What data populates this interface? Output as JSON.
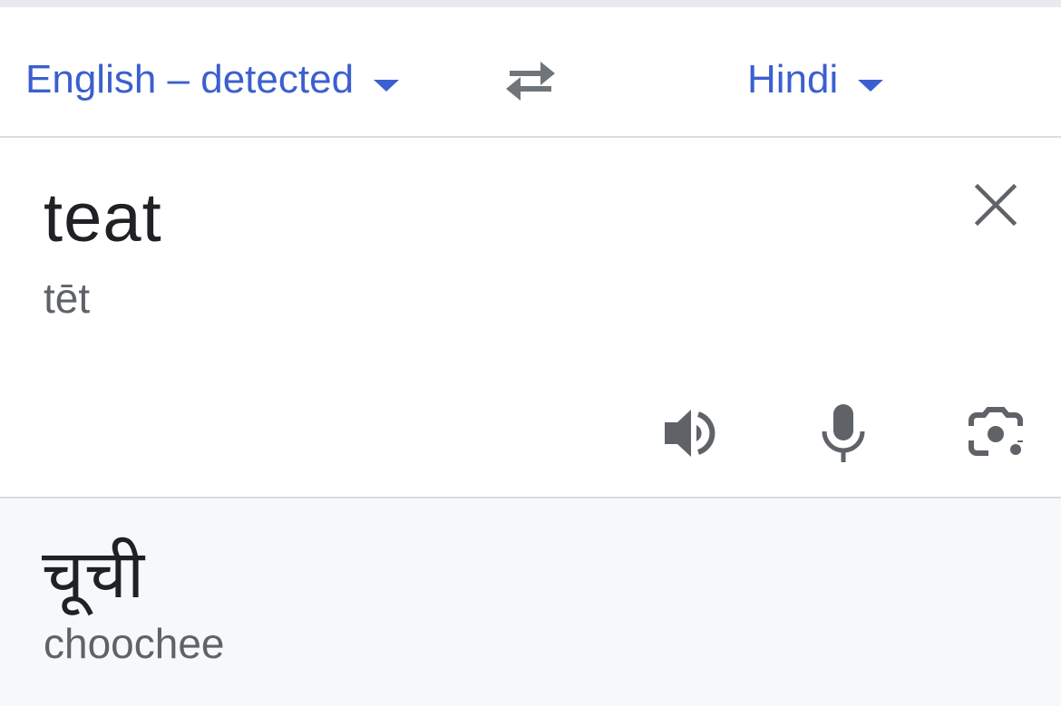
{
  "language_bar": {
    "source_language": "English – detected",
    "target_language": "Hindi",
    "swap_icon": "swap-arrows-icon",
    "accent_color": "#3c5fcf"
  },
  "input": {
    "text": "teat",
    "transliteration": "tēt",
    "clear_icon": "close-icon",
    "tools": [
      {
        "icon": "speaker-icon"
      },
      {
        "icon": "microphone-icon"
      },
      {
        "icon": "camera-lens-icon"
      }
    ]
  },
  "output": {
    "text": "चूची",
    "transliteration": "choochee",
    "background": "#f7f8fa"
  }
}
